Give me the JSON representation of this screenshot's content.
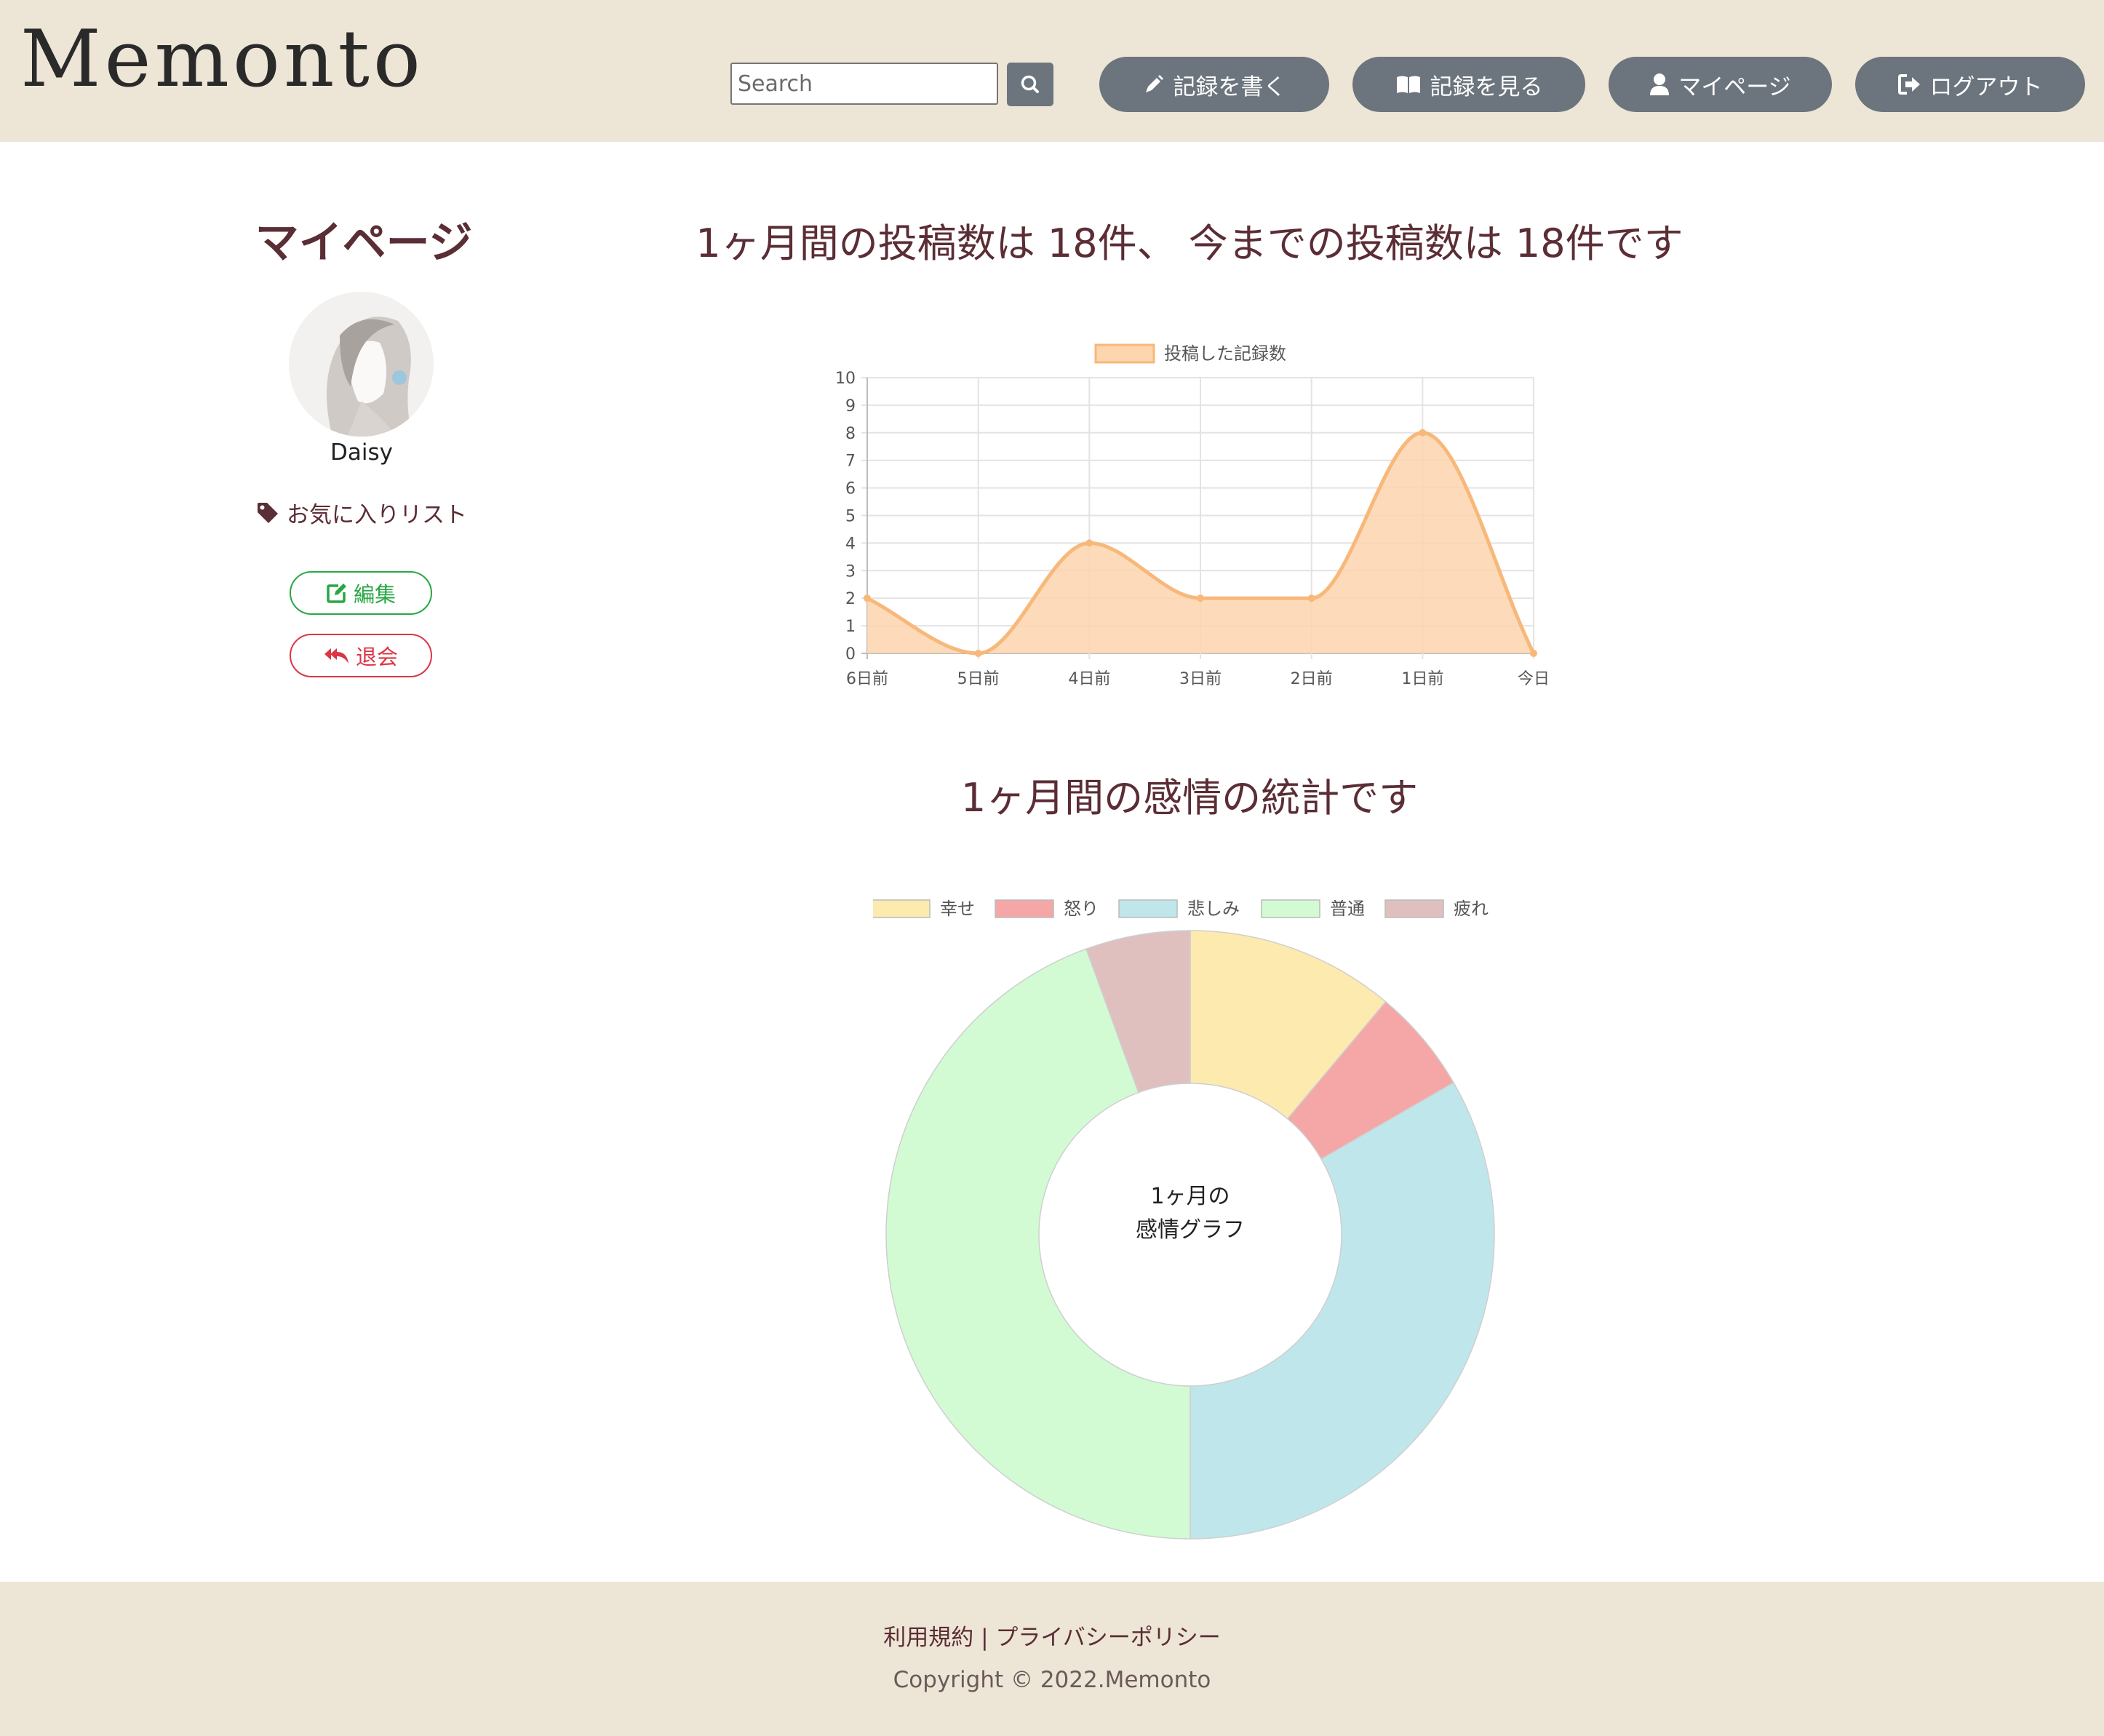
{
  "header": {
    "logo": "Memonto",
    "search": {
      "placeholder": "Search",
      "value": ""
    },
    "nav": [
      {
        "label": "記録を書く",
        "icon": "pen-icon"
      },
      {
        "label": "記録を見る",
        "icon": "book-open-icon"
      },
      {
        "label": "マイページ",
        "icon": "user-icon"
      },
      {
        "label": "ログアウト",
        "icon": "sign-out-icon"
      }
    ]
  },
  "sidebar": {
    "title": "マイページ",
    "username": "Daisy",
    "favorites_label": "お気に入りリスト",
    "edit_label": "編集",
    "withdraw_label": "退会"
  },
  "main": {
    "posts_summary": "1ヶ月間の投稿数は 18件、 今までの投稿数は 18件です",
    "emotion_heading": "1ヶ月間の感情の統計です"
  },
  "colors": {
    "header_bg": "#ede6d6",
    "text": "#5b2d34",
    "button_gray": "#6c757d",
    "edit_green": "#28a745",
    "withdraw_red": "#dc3545"
  },
  "chart_data": [
    {
      "type": "line",
      "x": [
        "6日前",
        "5日前",
        "4日前",
        "3日前",
        "2日前",
        "1日前",
        "今日"
      ],
      "series": [
        {
          "name": "投稿した記録数",
          "values": [
            2,
            0,
            4,
            2,
            2,
            8,
            0
          ],
          "color": "#f7b87a",
          "fill": "#fdd5ae"
        }
      ],
      "ylim": [
        0,
        10
      ],
      "yticks": [
        0,
        1,
        2,
        3,
        4,
        5,
        6,
        7,
        8,
        9,
        10
      ],
      "grid": true,
      "legend": "top"
    },
    {
      "type": "pie",
      "categories": [
        "幸せ",
        "怒り",
        "悲しみ",
        "普通",
        "疲れ"
      ],
      "values": [
        2,
        1,
        6,
        8,
        1
      ],
      "colors": [
        "#fdeaae",
        "#f5a7a7",
        "#bfe7eb",
        "#d2fbd4",
        "#dfc0bf"
      ],
      "center_text": [
        "1ヶ月の",
        "感情グラフ"
      ],
      "legend": "top"
    }
  ],
  "footer": {
    "terms": "利用規約",
    "separator": "|",
    "privacy": "プライバシーポリシー",
    "copyright": "Copyright © 2022.Memonto"
  }
}
